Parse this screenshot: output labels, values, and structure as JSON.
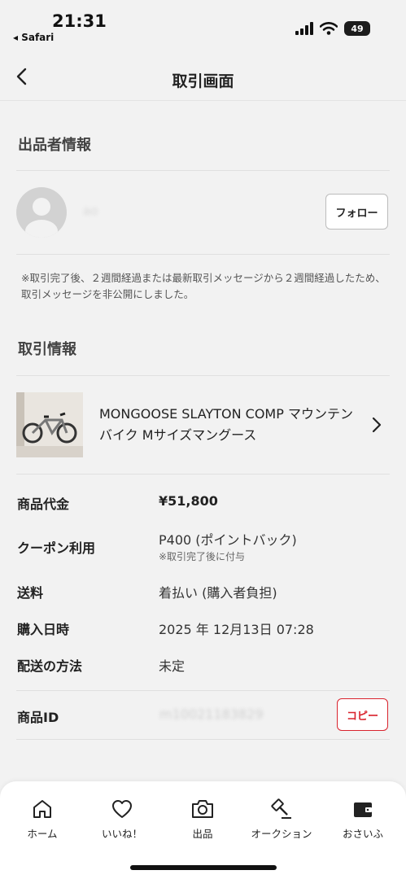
{
  "status_bar": {
    "time": "21:31",
    "back_app": "◂ Safari",
    "battery": "49"
  },
  "nav": {
    "title": "取引画面"
  },
  "seller": {
    "heading": "出品者情報",
    "name": "ao",
    "follow_label": "フォロー",
    "notice": "※取引完了後、２週間経過または最新取引メッセージから２週間経過したため、取引メッセージを非公開にしました。"
  },
  "transaction": {
    "heading": "取引情報",
    "product_name": "MONGOOSE SLAYTON COMP マウンテンバイク Mサイズマングース",
    "rows": [
      {
        "label": "商品代金",
        "value": "¥51,800",
        "bold": true
      },
      {
        "label": "クーポン利用",
        "value": "P400 (ポイントバック)",
        "sub": "※取引完了後に付与"
      },
      {
        "label": "送料",
        "value": "着払い (購入者負担)"
      },
      {
        "label": "購入日時",
        "value": "2025 年 12月13日 07:28"
      },
      {
        "label": "配送の方法",
        "value": "未定"
      }
    ],
    "product_id_label": "商品ID",
    "product_id_value": "m10021183829",
    "copy_label": "コピー"
  },
  "tabs": [
    {
      "label": "ホーム",
      "icon": "home-icon"
    },
    {
      "label": "いいね！",
      "icon": "heart-icon"
    },
    {
      "label": "出品",
      "icon": "camera-icon"
    },
    {
      "label": "オークション",
      "icon": "gavel-icon"
    },
    {
      "label": "おさいふ",
      "icon": "wallet-icon"
    }
  ],
  "colors": {
    "accent": "#d9232d",
    "background": "#f2f2f2"
  }
}
